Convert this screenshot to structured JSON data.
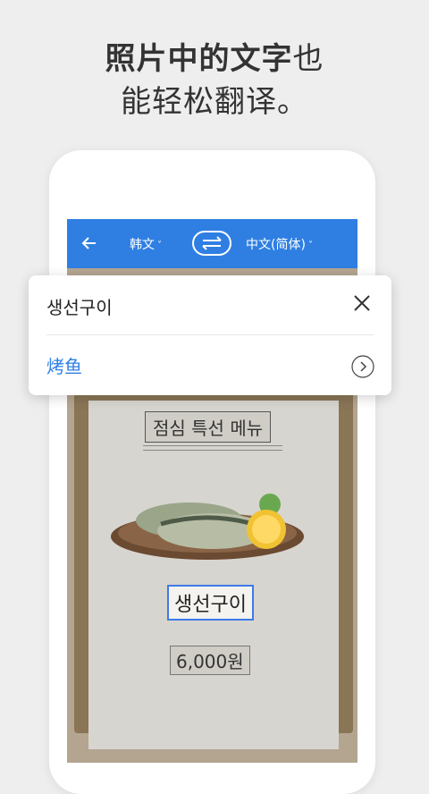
{
  "headline": {
    "line1_bold": "照片中的文字",
    "line1_rest": "也",
    "line2": "能轻松翻译。"
  },
  "topbar": {
    "source_lang": "韩文",
    "target_lang": "中文(简体)",
    "chevron": "˅"
  },
  "popup": {
    "source_text": "생선구이",
    "translation": "烤鱼"
  },
  "photo": {
    "menu_title": "점심 특선 메뉴",
    "dish_name": "생선구이",
    "price": "6,000원"
  },
  "colors": {
    "accent": "#2f7fe3",
    "highlight_box": "#3e7ae8"
  },
  "icons": {
    "back": "arrow-left-icon",
    "swap": "swap-arrows-icon",
    "close": "close-icon",
    "more": "chevron-right-circle-icon"
  }
}
